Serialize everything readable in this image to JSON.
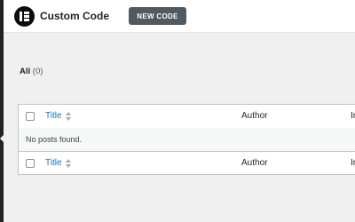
{
  "header": {
    "logo_icon": "elementor-logo-icon",
    "title": "Custom Code",
    "new_button_label": "NEW CODE"
  },
  "filter": {
    "current_label": "All",
    "current_count": "(0)"
  },
  "table": {
    "columns": {
      "title": "Title",
      "author": "Author",
      "extra": "In"
    },
    "empty_message": "No posts found."
  },
  "colors": {
    "sidebar": "#1d2327",
    "button_bg": "#515962",
    "link": "#2271b1",
    "page_bg": "#f0f0f1"
  }
}
